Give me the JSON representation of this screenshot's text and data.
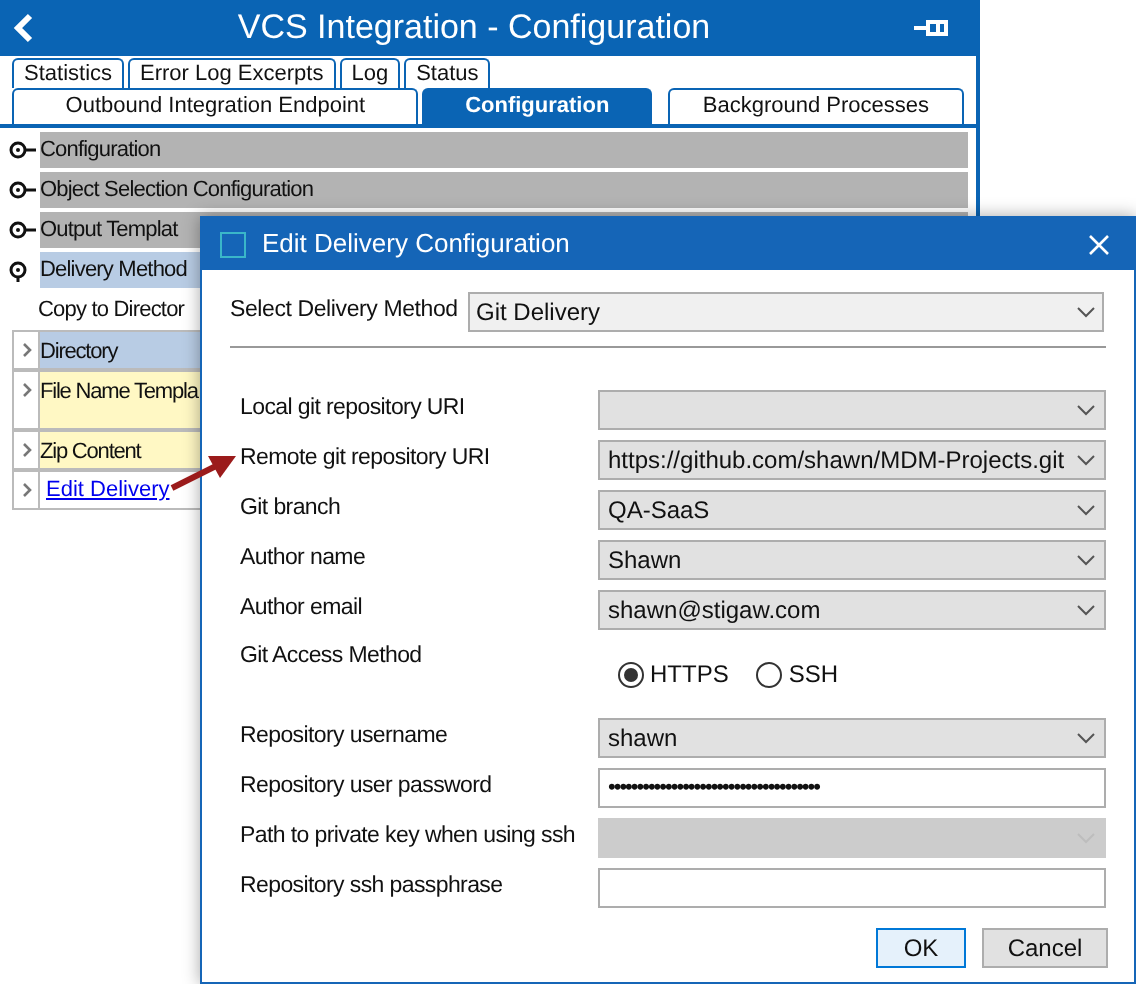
{
  "window": {
    "title": "VCS Integration - Configuration"
  },
  "tabs_row_1": [
    {
      "label": "Statistics",
      "selected": false
    },
    {
      "label": "Error Log Excerpts",
      "selected": false
    },
    {
      "label": "Log",
      "selected": false
    },
    {
      "label": "Status",
      "selected": false
    }
  ],
  "tabs_row_2": [
    {
      "label": "Outbound Integration Endpoint",
      "selected": false
    },
    {
      "label": "Configuration",
      "selected": true
    },
    {
      "label": "Background Processes",
      "selected": false
    }
  ],
  "sections": [
    {
      "label": "Configuration",
      "expanded": false,
      "selected": false
    },
    {
      "label": "Object Selection Configuration",
      "expanded": false,
      "selected": false
    },
    {
      "label": "Output Templat",
      "expanded": false,
      "selected": false
    },
    {
      "label": "Delivery Method",
      "expanded": true,
      "selected": true
    }
  ],
  "delivery_value": "Copy to Director",
  "properties": [
    {
      "label": "Directory",
      "kind": "selected"
    },
    {
      "label": "File Name Templa",
      "kind": "plain"
    },
    {
      "label": "Zip Content",
      "kind": "plain"
    },
    {
      "label": "Edit Delivery",
      "kind": "link"
    }
  ],
  "dialog": {
    "title": "Edit Delivery Configuration",
    "method": {
      "label": "Select Delivery Method",
      "value": "Git Delivery"
    },
    "fields": [
      {
        "label": "Local git repository URI",
        "kind": "select",
        "disabled": false
      },
      {
        "label": "Remote git repository URI",
        "kind": "select",
        "value": "https://github.com/shawn/MDM-Projects.git",
        "disabled": false
      },
      {
        "label": "Git branch",
        "kind": "select",
        "value": "QA-SaaS",
        "disabled": false
      },
      {
        "label": "Author name",
        "kind": "select",
        "value": "Shawn",
        "disabled": false
      },
      {
        "label": "Author email",
        "kind": "select",
        "value": "shawn@stigaw.com",
        "disabled": false
      },
      {
        "label": "Git Access Method",
        "kind": "radio",
        "options": [
          {
            "label": "HTTPS",
            "selected": true
          },
          {
            "label": "SSH",
            "selected": false
          }
        ]
      },
      {
        "label": "Repository username",
        "kind": "select",
        "value": "shawn",
        "disabled": false
      },
      {
        "label": "Repository user password",
        "kind": "password",
        "value": "•••••••••••••••••••••••••••••••••••••"
      },
      {
        "label": "Path to private key when using ssh",
        "kind": "select",
        "disabled": true
      },
      {
        "label": "Repository ssh passphrase",
        "kind": "text"
      }
    ],
    "buttons": [
      "OK",
      "Cancel"
    ]
  }
}
